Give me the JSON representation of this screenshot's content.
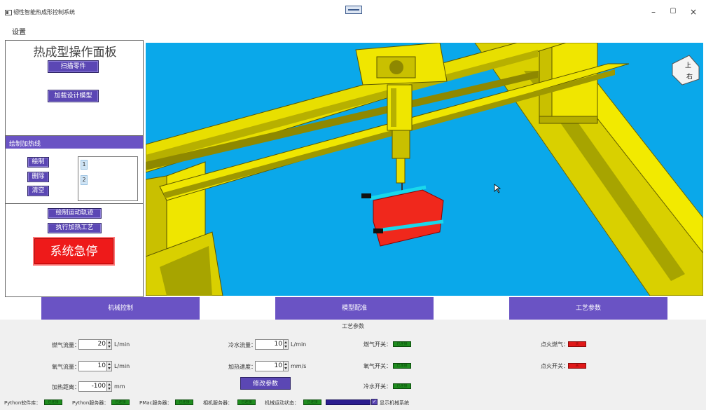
{
  "window": {
    "title": "韧性智能热成形控制系统",
    "minimize_glyph": "–",
    "maximize_glyph": "▢",
    "close_glyph": "×"
  },
  "menu": {
    "settings": "设置"
  },
  "left_panel": {
    "title": "热成型操作面板",
    "scan_button": "扫描零件",
    "load_model_button": "加载设计模型",
    "draw_group": {
      "header": "绘制加热线",
      "draw_button": "绘制",
      "delete_button": "删除",
      "clear_button": "清空",
      "list_items": [
        "1",
        "2"
      ]
    },
    "draw_path_button": "绘制运动轨迹",
    "run_heating_button": "执行加热工艺",
    "estop_button": "系统急停"
  },
  "viewport": {
    "view_cube": {
      "top_face": "上",
      "right_face": "右"
    },
    "icon": "cad-3d-view"
  },
  "tabs": [
    "机械控制",
    "模型配准",
    "工艺参数"
  ],
  "params": {
    "title": "工艺参数",
    "fields": [
      {
        "label": "燃气流量：",
        "value": "20",
        "unit": "L/min"
      },
      {
        "label": "氧气流量：",
        "value": "10",
        "unit": "L/min"
      },
      {
        "label": "加热距离：",
        "value": "-100",
        "unit": "mm"
      },
      {
        "label": "冷水流量：",
        "value": "10",
        "unit": "L/min"
      },
      {
        "label": "加热速度：",
        "value": "10",
        "unit": "mm/s"
      }
    ],
    "modify_button": "修改参数",
    "switches": [
      {
        "label": "燃气开关：",
        "state": "已连接",
        "color": "#1f8c1f"
      },
      {
        "label": "氧气开关：",
        "state": "已连接",
        "color": "#1f8c1f"
      },
      {
        "label": "冷水开关：",
        "state": "已连接",
        "color": "#1f8c1f"
      },
      {
        "label": "点火燃气：",
        "state": "关",
        "color": "#e01818"
      },
      {
        "label": "点火开关：",
        "state": "关",
        "color": "#e01818"
      }
    ]
  },
  "status": {
    "items": [
      {
        "label": "Python软件库：",
        "state": "已连接"
      },
      {
        "label": "Python服务器：",
        "state": "已连接"
      },
      {
        "label": "PMac服务器：",
        "state": "已连接"
      },
      {
        "label": "相机服务器：",
        "state": "已连接"
      },
      {
        "label": "机械运动状态：",
        "state": "已连接"
      }
    ],
    "show_machine_label": "显示机械系统",
    "show_machine_checked": true
  },
  "colors": {
    "accent": "#6a53c4",
    "viewport_bg": "#0aa8ea",
    "frame_yellow": "#e8e200",
    "estop_red": "#ee1a1a"
  }
}
